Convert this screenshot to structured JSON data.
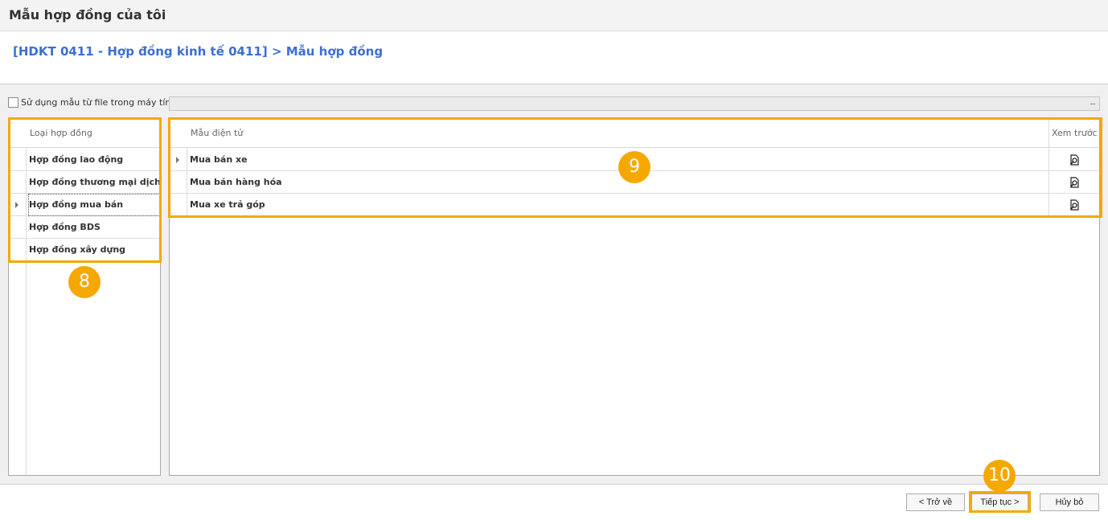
{
  "window": {
    "title": "Mẫu hợp đồng của tôi"
  },
  "breadcrumb": "[HDKT 0411 - Hợp đồng kinh tế 0411] > Mẫu hợp đồng",
  "use_file": {
    "label": "Sử dụng mẫu từ file trong máy tính:",
    "checked": false,
    "path_value": "",
    "browse_label": "..."
  },
  "contract_types": {
    "header": "Loại hợp đồng",
    "selected_index": 2,
    "items": [
      "Hợp đồng lao động",
      "Hợp đồng thương mại dịch ...",
      "Hợp đồng mua bán",
      "Hợp đồng BDS",
      "Hợp đồng xây dựng"
    ]
  },
  "templates": {
    "header_name": "Mẫu điện tử",
    "header_preview": "Xem trước",
    "selected_index": 0,
    "items": [
      "Mua bán xe",
      "Mua bán hàng hóa",
      "Mua xe trả góp"
    ],
    "preview_icon": "preview-document-icon"
  },
  "callouts": {
    "left_grid": "8",
    "right_grid": "9",
    "continue_button": "10",
    "color": "#f5a800"
  },
  "footer": {
    "back_label": "< Trở về",
    "continue_label": "Tiếp tục >",
    "cancel_label": "Hủy bỏ"
  },
  "colors": {
    "breadcrumb": "#3b6fd4",
    "highlight": "#f5a800"
  }
}
